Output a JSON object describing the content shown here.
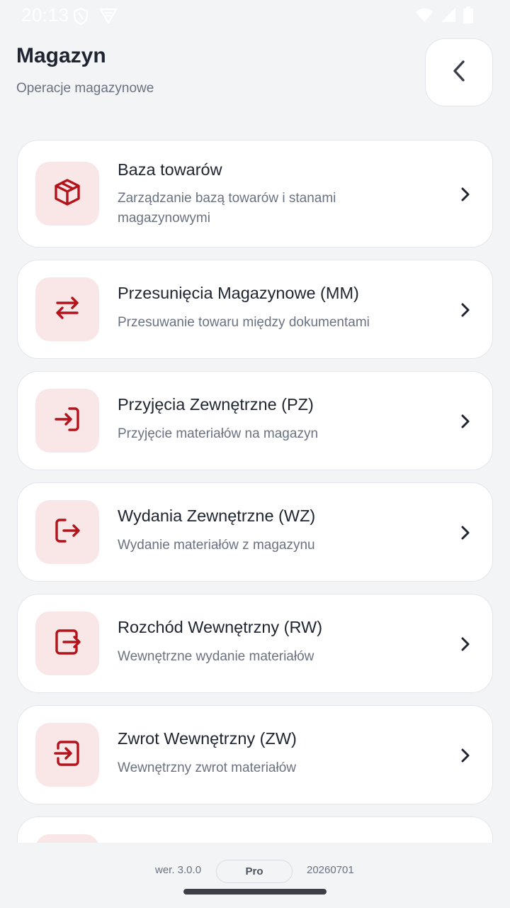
{
  "status_bar": {
    "time": "20:13",
    "left_icons": [
      "shield-icon",
      "vpn-icon"
    ],
    "right_icons": [
      "wifi-icon",
      "cellular-icon",
      "battery-icon"
    ]
  },
  "header": {
    "title": "Magazyn",
    "subtitle": "Operacje magazynowe",
    "back_icon": "chevron-left-icon"
  },
  "menu": {
    "items": [
      {
        "title": "Baza towarów",
        "description": "Zarządzanie bazą towarów i stanami magazynowymi",
        "icon": "box-icon"
      },
      {
        "title": "Przesunięcia Magazynowe (MM)",
        "description": "Przesuwanie towaru między dokumentami",
        "icon": "transfer-arrows-icon"
      },
      {
        "title": "Przyjęcia Zewnętrzne (PZ)",
        "description": "Przyjęcie materiałów na magazyn",
        "icon": "log-in-icon"
      },
      {
        "title": "Wydania Zewnętrzne (WZ)",
        "description": "Wydanie materiałów z magazynu",
        "icon": "log-out-icon"
      },
      {
        "title": "Rozchód Wewnętrzny (RW)",
        "description": "Wewnętrzne wydanie materiałów",
        "icon": "box-arrow-out-icon"
      },
      {
        "title": "Zwrot Wewnętrzny (ZW)",
        "description": "Wewnętrzny zwrot materiałów",
        "icon": "box-arrow-in-icon"
      }
    ]
  },
  "footer": {
    "version": "wer. 3.0.0",
    "edition": "Pro",
    "build": "20260701"
  },
  "colors": {
    "accent": "#b3141b",
    "icon_tile": "#f9e7e8",
    "background": "#f3f4f6"
  }
}
